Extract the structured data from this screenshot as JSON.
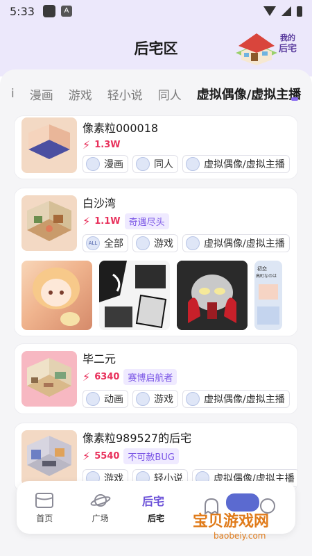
{
  "status_bar": {
    "time": "5:33"
  },
  "header": {
    "title": "后宅区"
  },
  "logo": {
    "line1": "我的",
    "line2": "后宅"
  },
  "tabs": [
    {
      "label": "i"
    },
    {
      "label": "漫画"
    },
    {
      "label": "游戏"
    },
    {
      "label": "轻小说"
    },
    {
      "label": "同人"
    },
    {
      "label": "虚拟偶像/虚拟主播"
    }
  ],
  "cards": [
    {
      "name": "像素粒000018",
      "heat": "1.3W",
      "categories": [
        {
          "label": "漫画",
          "icon": "category-icon"
        },
        {
          "label": "同人",
          "icon": "category-icon"
        },
        {
          "label": "虚拟偶像/虚拟主播",
          "icon": "category-icon"
        }
      ]
    },
    {
      "name": "白沙湾",
      "heat": "1.1W",
      "badge": "奇遇尽头",
      "categories": [
        {
          "label": "全部",
          "icon": "all-icon",
          "icon_text": "ALL"
        },
        {
          "label": "游戏",
          "icon": "category-icon"
        },
        {
          "label": "虚拟偶像/虚拟主播",
          "icon": "category-icon"
        }
      ]
    },
    {
      "name": "毕二元",
      "heat": "6340",
      "badge": "赛博启航者",
      "categories": [
        {
          "label": "动画",
          "icon": "video-icon"
        },
        {
          "label": "游戏",
          "icon": "category-icon"
        },
        {
          "label": "虚拟偶像/虚拟主播",
          "icon": "category-icon"
        }
      ]
    },
    {
      "name": "像素粒989527的后宅",
      "heat": "5540",
      "badge": "不可赦BUG",
      "categories": [
        {
          "label": "游戏",
          "icon": "category-icon"
        },
        {
          "label": "轻小说",
          "icon": "category-icon"
        },
        {
          "label": "虚拟偶像/虚拟主播",
          "icon": "category-icon"
        }
      ]
    }
  ],
  "gallery_text": {
    "line1": "初恋",
    "line2": "高町なのは"
  },
  "nav": [
    {
      "label": "首页",
      "icon": "home-icon"
    },
    {
      "label": "广场",
      "icon": "planet-icon"
    },
    {
      "label": "后宅",
      "icon": "houzhai-icon",
      "icon_text": "后宅"
    },
    {
      "label": "",
      "icon": "ghost-icon"
    },
    {
      "label": "",
      "icon": "profile-icon"
    }
  ],
  "watermark": {
    "text": "宝贝游戏网",
    "url": "baobeiy.com"
  },
  "colors": {
    "accent": "#8a6cf0",
    "heat": "#e8305b",
    "header_bg": "#ece8fb",
    "watermark": "#e07b1a"
  }
}
